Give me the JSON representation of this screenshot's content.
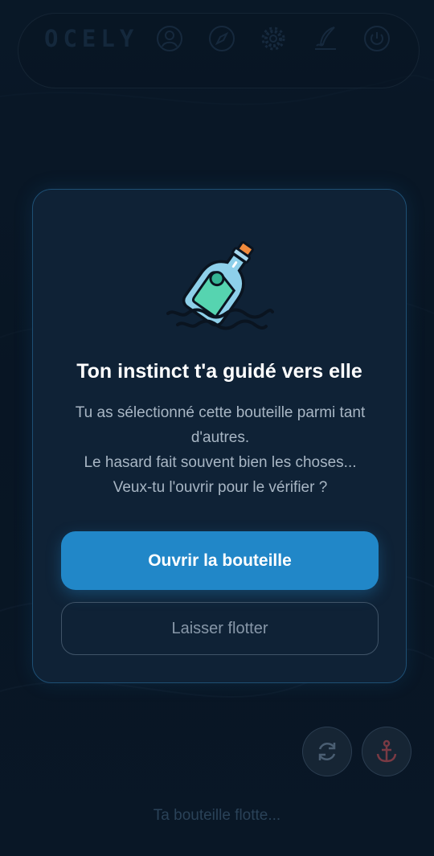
{
  "app": {
    "logo_text": "OCELY"
  },
  "nav": {
    "items": [
      {
        "icon": "profile-icon"
      },
      {
        "icon": "compass-icon"
      },
      {
        "icon": "settings-gear-icon"
      },
      {
        "icon": "quill-write-icon"
      },
      {
        "icon": "power-icon"
      }
    ]
  },
  "modal": {
    "illustration": "message-in-bottle-icon",
    "title": "Ton instinct t'a guidé vers elle",
    "message_lines": [
      "Tu as sélectionné cette bouteille parmi tant",
      "d'autres.",
      "Le hasard fait souvent bien les choses...",
      "Veux-tu l'ouvrir pour le vérifier ?"
    ],
    "primary_button": "Ouvrir la bouteille",
    "secondary_button": "Laisser flotter"
  },
  "actions": {
    "refresh_icon": "refresh-icon",
    "anchor_icon": "anchor-icon"
  },
  "status": {
    "floating_text": "Ta bouteille flotte..."
  },
  "colors": {
    "accent": "#2187c8",
    "background": "#0b1c2e",
    "modal_border": "#1e4f74"
  }
}
